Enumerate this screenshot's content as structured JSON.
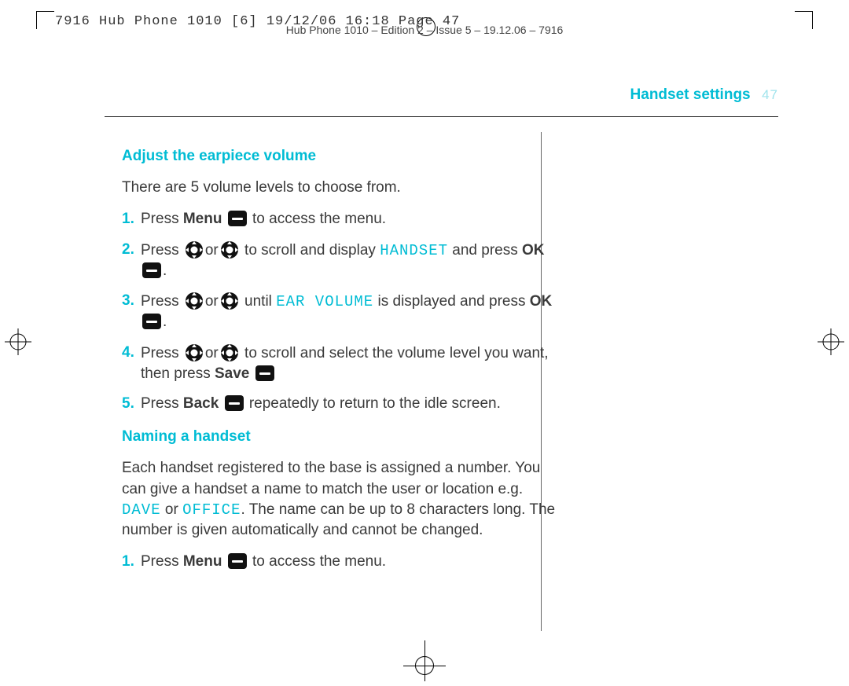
{
  "header": {
    "proof_line": "7916 Hub Phone 1010 [6]  19/12/06  16:18  Page 47",
    "sub_line": "Hub Phone 1010 – Edition 2 – Issue 5 – 19.12.06 – 7916"
  },
  "page": {
    "section_title": "Handset settings",
    "number": "47"
  },
  "sections": [
    {
      "heading": "Adjust the earpiece volume",
      "intro": "There are 5 volume levels to choose from.",
      "steps": [
        {
          "n": "1.",
          "pre": "Press ",
          "kw": "Menu",
          "icon": "box",
          "post": " to access the menu."
        },
        {
          "n": "2.",
          "pre": "Press ",
          "icon_pair": true,
          "mid": " to scroll and display ",
          "lcd": "HANDSET",
          "post2": " and press ",
          "kw2": "OK",
          "icon2": "box",
          "tail": "."
        },
        {
          "n": "3.",
          "pre": "Press ",
          "icon_pair": true,
          "mid": " until ",
          "lcd": "EAR VOLUME",
          "post2": " is displayed and press ",
          "kw2": "OK",
          "icon2": "box",
          "tail": "."
        },
        {
          "n": "4.",
          "pre": "Press ",
          "icon_pair": true,
          "mid": " to scroll and select the volume level you want, then press ",
          "kw2": "Save",
          "icon2": "box",
          "tail": ""
        },
        {
          "n": "5.",
          "pre": "Press ",
          "kw": "Back",
          "icon": "box",
          "post": " repeatedly to return to the idle screen."
        }
      ]
    },
    {
      "heading": "Naming a handset",
      "intro_parts": {
        "a": "Each handset registered to the base is assigned a number. You can give a handset a name to match the user or location e.g. ",
        "lcd1": "DAVE",
        "b": " or ",
        "lcd2": "OFFICE",
        "c": ". The name can be up to 8 characters long. The number is given automatically and cannot be changed."
      },
      "steps": [
        {
          "n": "1.",
          "pre": "Press ",
          "kw": "Menu",
          "icon": "box",
          "post": " to access the menu."
        }
      ]
    }
  ],
  "strings": {
    "or": "or"
  }
}
